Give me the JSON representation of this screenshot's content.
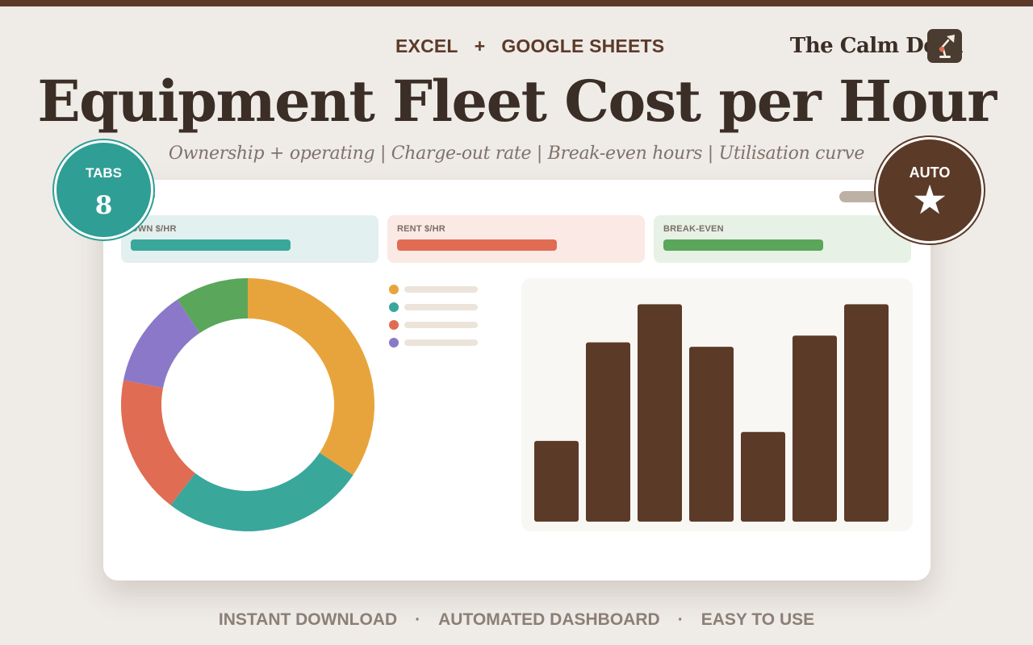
{
  "header": {
    "platform_left": "EXCEL",
    "platform_join": "+",
    "platform_right": "GOOGLE SHEETS",
    "brand": "The Calm Desk",
    "brand_icon": "desk-lamp-icon"
  },
  "title": "Equipment Fleet Cost per Hour",
  "subtitle": "Ownership + operating | Charge-out rate | Break-even hours | Utilisation curve",
  "badges": {
    "tabs_label": "TABS",
    "tabs_value": "8",
    "auto_label": "AUTO",
    "auto_icon": "star-icon"
  },
  "kpis": [
    {
      "label": "OWN $/HR",
      "color": "#3aa79b"
    },
    {
      "label": "RENT $/HR",
      "color": "#e06c53"
    },
    {
      "label": "BREAK-EVEN",
      "color": "#5aa65a"
    }
  ],
  "chart_data": [
    {
      "type": "pie",
      "donut": true,
      "values": [
        33,
        25,
        17,
        12,
        9
      ],
      "colors": [
        "#e8a43c",
        "#3aa79b",
        "#e06c53",
        "#8b78c9",
        "#5aa65a"
      ]
    },
    {
      "type": "bar",
      "values": [
        36,
        80,
        97,
        78,
        40,
        83,
        97
      ],
      "ylim": [
        0,
        100
      ],
      "colors": [
        "#5c3a28"
      ]
    }
  ],
  "legend_colors": [
    "#e8a43c",
    "#3aa79b",
    "#e06c53",
    "#8b78c9"
  ],
  "footer": {
    "item1": "INSTANT DOWNLOAD",
    "sep": "·",
    "item2": "AUTOMATED DASHBOARD",
    "item3": "EASY TO USE"
  }
}
